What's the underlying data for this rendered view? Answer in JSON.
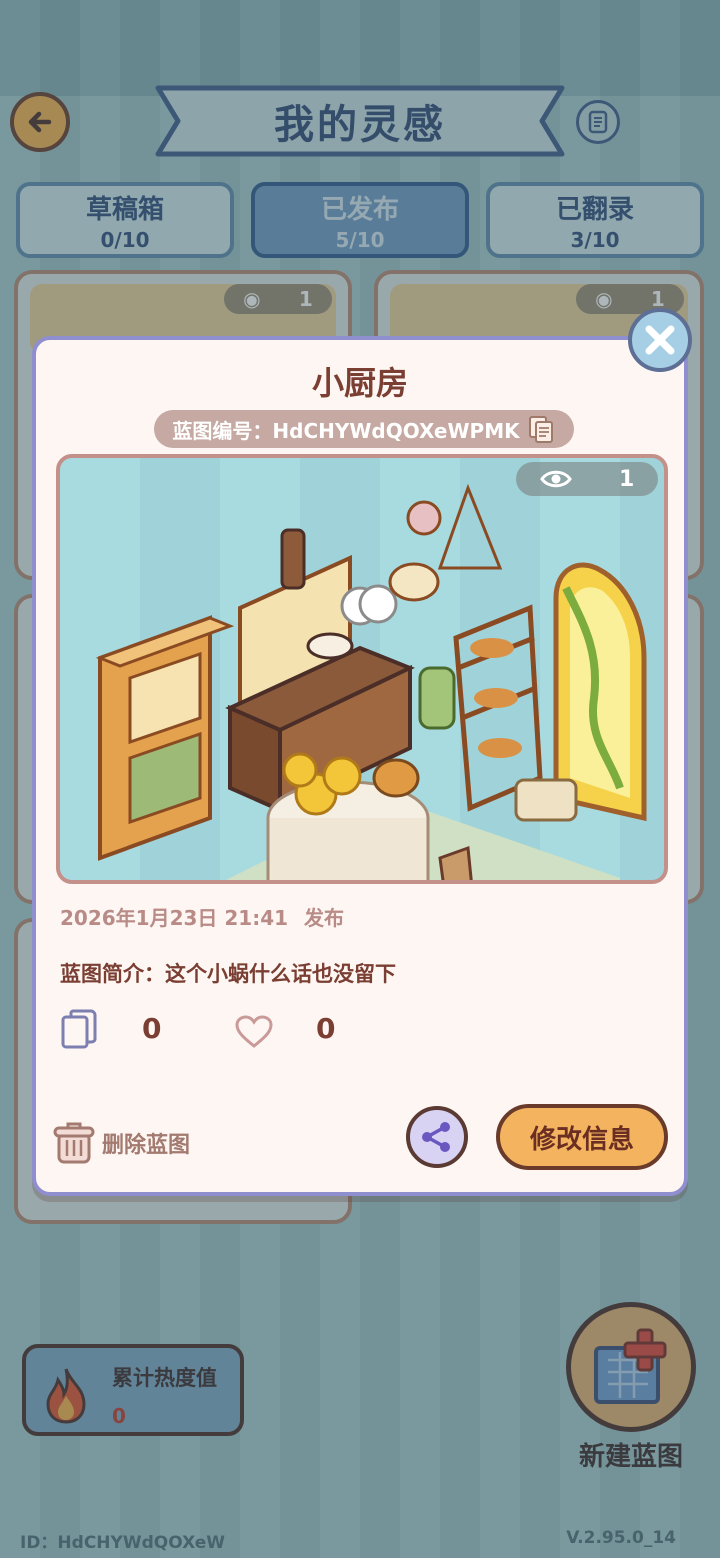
{
  "header": {
    "title": "我的灵感"
  },
  "tabs": [
    {
      "label": "草稿箱",
      "count": "0/10",
      "active": false
    },
    {
      "label": "已发布",
      "count": "5/10",
      "active": true
    },
    {
      "label": "已翻录",
      "count": "3/10",
      "active": false
    }
  ],
  "background_cards": {
    "views": "1"
  },
  "heat": {
    "label": "累计热度值",
    "value": "0"
  },
  "new_blueprint": {
    "label": "新建蓝图"
  },
  "footer": {
    "id_text": "ID：HdCHYWdQOXeW",
    "version": "V.2.95.0_14"
  },
  "modal": {
    "title": "小厨房",
    "code_label": "蓝图编号：HdCHYWdQOXeWPMK",
    "views": "1",
    "date": "2026年1月23日 21:41",
    "status": "发布",
    "description": "蓝图简介：这个小蜗什么话也没留下",
    "copy_count": "0",
    "like_count": "0",
    "delete_label": "删除蓝图",
    "edit_label": "修改信息"
  },
  "colors": {
    "accent_orange": "#f4b45f",
    "title_brown": "#7a3e33",
    "tab_active": "#6e9ec4",
    "modal_border": "#8f8fd0"
  },
  "icons": [
    "back-arrow-icon",
    "scroll-icon",
    "eye-icon",
    "copy-icon",
    "heart-icon",
    "trash-icon",
    "share-icon",
    "close-icon",
    "flame-icon",
    "blueprint-plus-icon"
  ]
}
